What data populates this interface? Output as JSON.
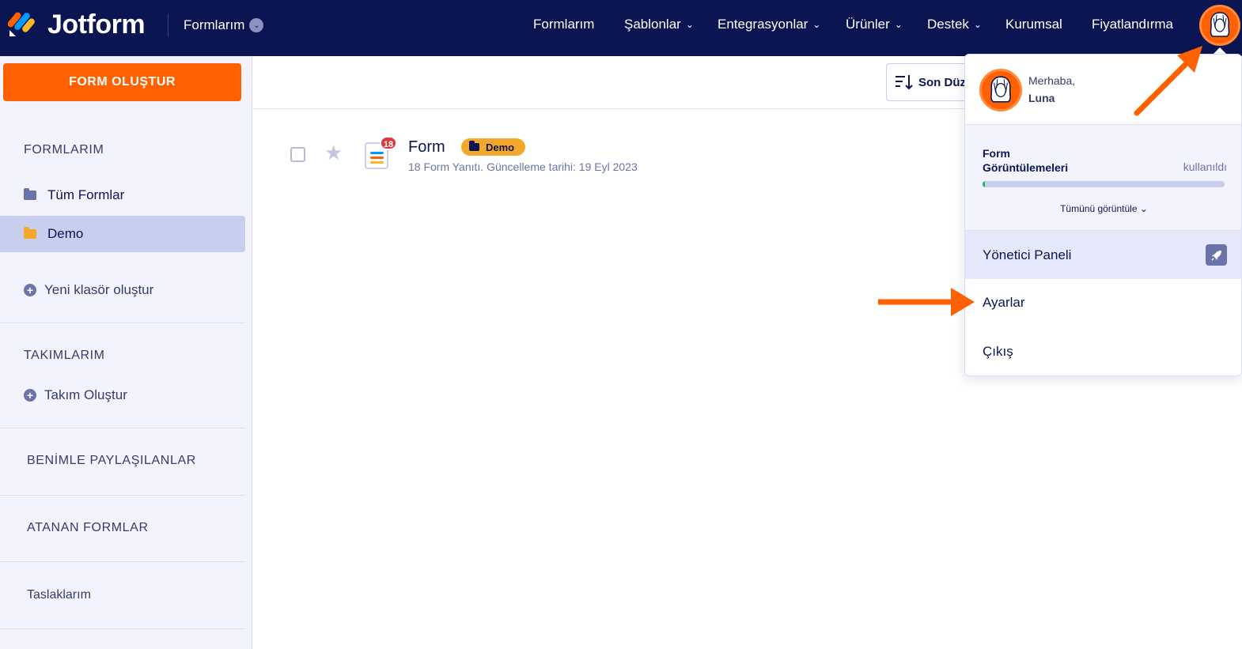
{
  "brand": {
    "name": "Jotform"
  },
  "workspace": {
    "label": "Formlarım"
  },
  "nav": {
    "items": [
      {
        "label": "Formlarım",
        "dropdown": false
      },
      {
        "label": "Şablonlar",
        "dropdown": true
      },
      {
        "label": "Entegrasyonlar",
        "dropdown": true
      },
      {
        "label": "Ürünler",
        "dropdown": true
      },
      {
        "label": "Destek",
        "dropdown": true
      },
      {
        "label": "Kurumsal",
        "dropdown": false
      },
      {
        "label": "Fiyatlandırma",
        "dropdown": false
      }
    ]
  },
  "sidebar": {
    "create_button": "FORM OLUŞTUR",
    "forms_heading": "FORMLARIM",
    "folders": [
      {
        "label": "Tüm Formlar",
        "color": "#6c73a8",
        "active": false
      },
      {
        "label": "Demo",
        "color": "#f4a82b",
        "active": true
      }
    ],
    "new_folder": "Yeni klasör oluştur",
    "teams_heading": "TAKIMLARIM",
    "create_team": "Takım Oluştur",
    "shared_with_me": "BENİMLE PAYLAŞILANLAR",
    "assigned_forms": "ATANAN FORMLAR",
    "drafts": "Taslaklarım"
  },
  "toolbar": {
    "sort_label": "Son Düz"
  },
  "form_list": [
    {
      "title": "Form",
      "folder_badge": "Demo",
      "response_count": "18",
      "meta": "18 Form Yanıtı. Güncelleme tarihi: 19 Eyl 2023"
    }
  ],
  "account_menu": {
    "greeting": "Merhaba,",
    "user_name": "Luna",
    "usage_label_line1": "Form",
    "usage_label_line2": "Görüntülemeleri",
    "usage_status": "kullanıldı",
    "usage_fraction": 0.01,
    "view_all": "Tümünü görüntüle",
    "admin_panel": "Yönetici Paneli",
    "settings": "Ayarlar",
    "logout": "Çıkış"
  },
  "colors": {
    "navy": "#0a1551",
    "orange": "#ff6100",
    "demo_badge": "#f4a82b",
    "progress": "#18bd5b"
  },
  "icons": {
    "logo": "jotform-logo-icon",
    "sort": "sort-icon",
    "star": "star-icon",
    "rocket": "rocket-icon",
    "folder": "folder-icon"
  }
}
